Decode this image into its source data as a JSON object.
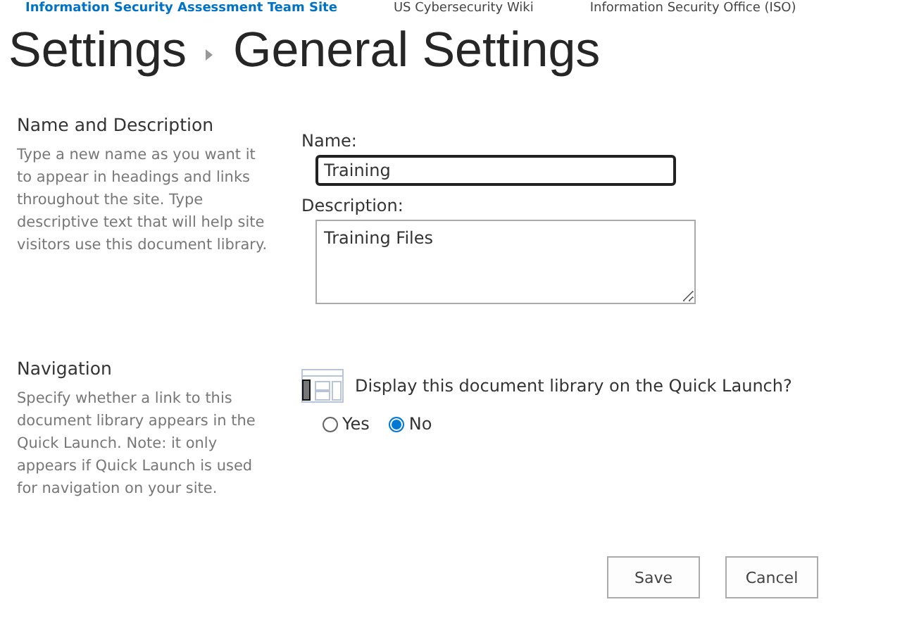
{
  "top_links": [
    {
      "label": "Information Security Assessment Team Site",
      "kind": "link"
    },
    {
      "label": "US Cybersecurity Wiki",
      "kind": "plain"
    },
    {
      "label": "Information Security Office (ISO)",
      "kind": "plain"
    }
  ],
  "breadcrumb": [
    "Settings",
    "General Settings"
  ],
  "sections": [
    {
      "kind": "name",
      "title": "Name and Description",
      "description": "Type a new name as you want it to appear in headings and links throughout the site. Type descriptive text that will help site visitors use this document library.",
      "name_label": "Name:",
      "name_value": "Training",
      "description_label": "Description:",
      "description_value": "Training Files"
    },
    {
      "kind": "navigation",
      "title": "Navigation",
      "description": "Specify whether a link to this document library appears in the Quick Launch. Note: it only appears if Quick Launch is used for navigation on your site.",
      "question": "Display this document library on the Quick Launch?",
      "options": [
        {
          "label": "Yes",
          "selected": false
        },
        {
          "label": "No",
          "selected": true
        }
      ]
    }
  ],
  "buttons": [
    "Save",
    "Cancel"
  ]
}
